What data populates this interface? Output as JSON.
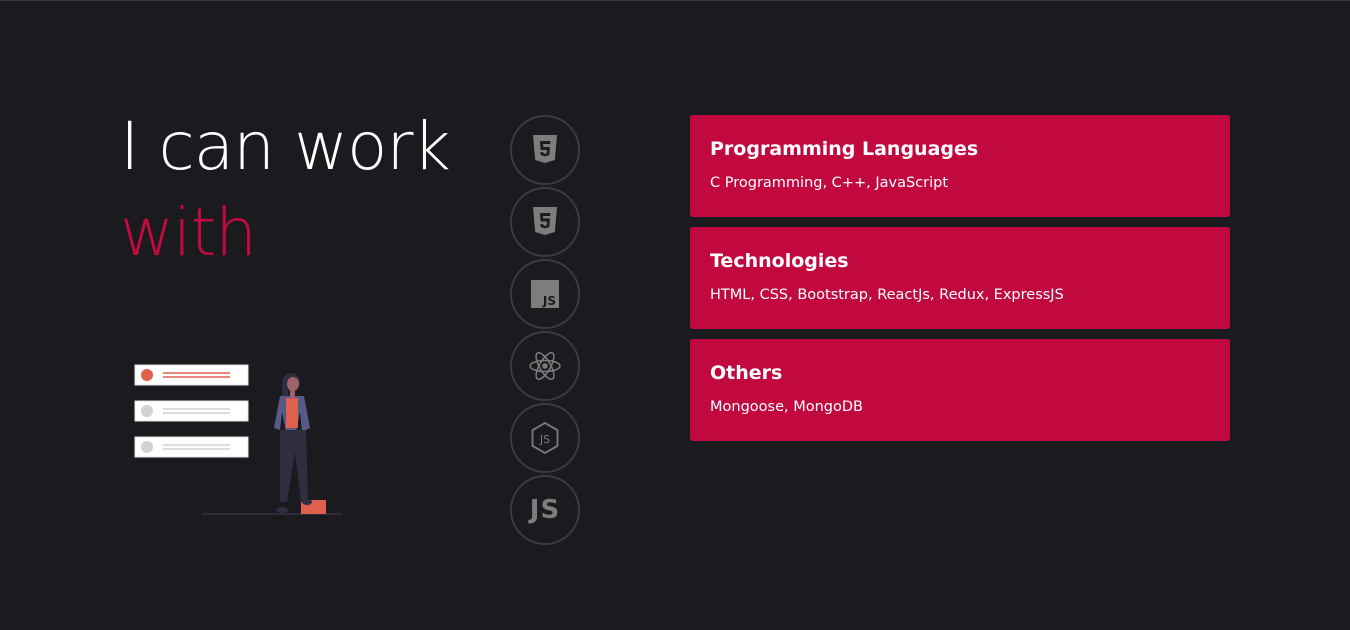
{
  "heading": {
    "line1": "I can work",
    "line2": "with"
  },
  "colors": {
    "background": "#1b1a1f",
    "accent": "#c2093f",
    "icon_gray": "#7d7d7d",
    "ring": "#3a3a40"
  },
  "tech_icons": [
    {
      "name": "html5-icon"
    },
    {
      "name": "css3-icon"
    },
    {
      "name": "javascript-icon"
    },
    {
      "name": "react-icon"
    },
    {
      "name": "nodejs-icon"
    },
    {
      "name": "js-text-icon",
      "label": "JS"
    }
  ],
  "skills": [
    {
      "title": "Programming Languages",
      "text": "C Programming, C++, JavaScript"
    },
    {
      "title": "Technologies",
      "text": "HTML, CSS, Bootstrap, ReactJs, Redux, ExpressJS"
    },
    {
      "title": "Others",
      "text": "Mongoose, MongoDB"
    }
  ]
}
